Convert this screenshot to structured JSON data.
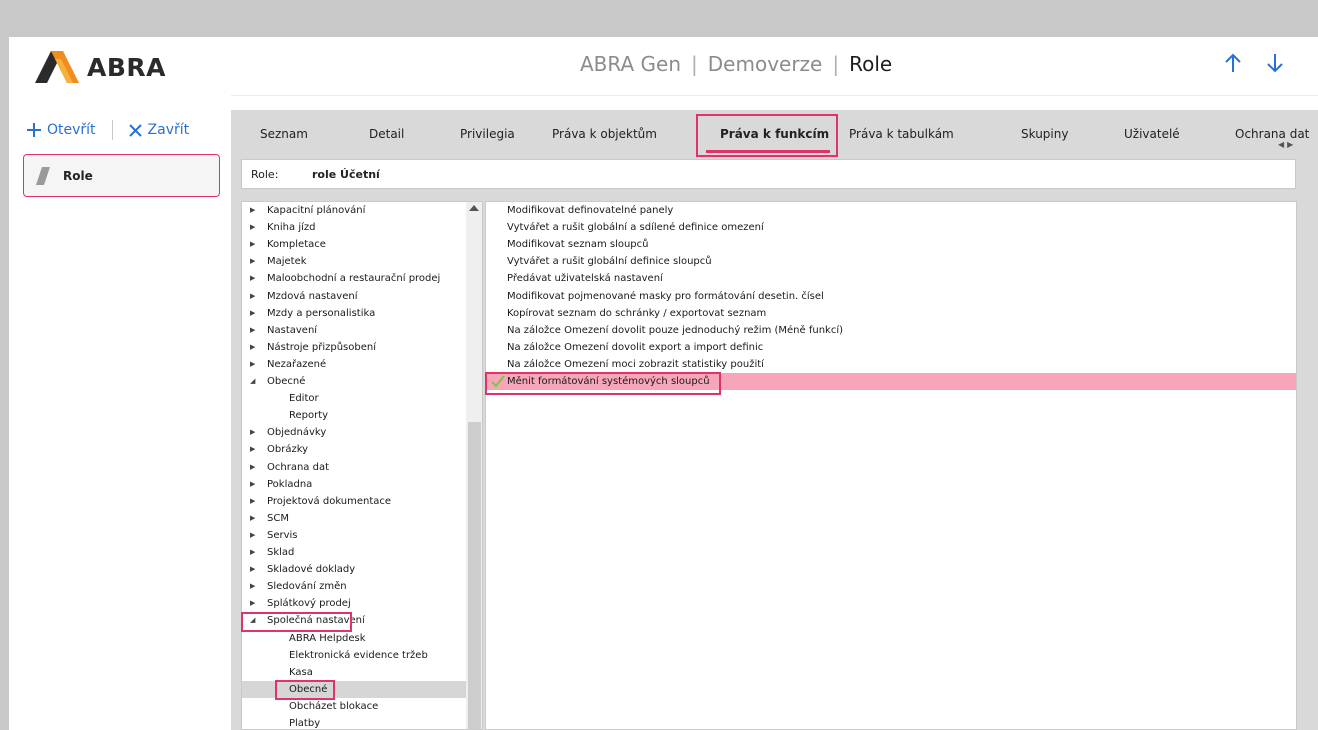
{
  "app": {
    "logo_text": "ABRA",
    "title_parts": [
      "ABRA Gen",
      "Demoverze",
      "Role"
    ]
  },
  "nav": {
    "up_icon": "arrow-up-icon",
    "down_icon": "arrow-down-icon"
  },
  "actions": {
    "open_label": "Otevřít",
    "close_label": "Zavřít"
  },
  "left": {
    "role_label": "Role"
  },
  "tabs": [
    {
      "label": "Seznam",
      "active": false
    },
    {
      "label": "Detail",
      "active": false
    },
    {
      "label": "Privilegia",
      "active": false
    },
    {
      "label": "Práva k objektům",
      "active": false
    },
    {
      "label": "Práva k funkcím",
      "active": true
    },
    {
      "label": "Práva k tabulkám",
      "active": false
    },
    {
      "label": "Skupiny",
      "active": false
    },
    {
      "label": "Uživatelé",
      "active": false
    },
    {
      "label": "Ochrana dat",
      "active": false
    }
  ],
  "role_bar": {
    "key": "Role:",
    "value": "role Účetní"
  },
  "tree": [
    {
      "label": "Kapacitní plánování",
      "level": 0,
      "state": "collapsed"
    },
    {
      "label": "Kniha jízd",
      "level": 0,
      "state": "collapsed"
    },
    {
      "label": "Kompletace",
      "level": 0,
      "state": "collapsed"
    },
    {
      "label": "Majetek",
      "level": 0,
      "state": "collapsed"
    },
    {
      "label": "Maloobchodní a restaurační prodej",
      "level": 0,
      "state": "collapsed"
    },
    {
      "label": "Mzdová nastavení",
      "level": 0,
      "state": "collapsed"
    },
    {
      "label": "Mzdy a personalistika",
      "level": 0,
      "state": "collapsed"
    },
    {
      "label": "Nastavení",
      "level": 0,
      "state": "collapsed"
    },
    {
      "label": "Nástroje přizpůsobení",
      "level": 0,
      "state": "collapsed"
    },
    {
      "label": "Nezařazené",
      "level": 0,
      "state": "collapsed"
    },
    {
      "label": "Obecné",
      "level": 0,
      "state": "expanded"
    },
    {
      "label": "Editor",
      "level": 1,
      "state": "leaf"
    },
    {
      "label": "Reporty",
      "level": 1,
      "state": "leaf"
    },
    {
      "label": "Objednávky",
      "level": 0,
      "state": "collapsed"
    },
    {
      "label": "Obrázky",
      "level": 0,
      "state": "collapsed"
    },
    {
      "label": "Ochrana dat",
      "level": 0,
      "state": "collapsed"
    },
    {
      "label": "Pokladna",
      "level": 0,
      "state": "collapsed"
    },
    {
      "label": "Projektová dokumentace",
      "level": 0,
      "state": "collapsed"
    },
    {
      "label": "SCM",
      "level": 0,
      "state": "collapsed"
    },
    {
      "label": "Servis",
      "level": 0,
      "state": "collapsed"
    },
    {
      "label": "Sklad",
      "level": 0,
      "state": "collapsed"
    },
    {
      "label": "Skladové doklady",
      "level": 0,
      "state": "collapsed"
    },
    {
      "label": "Sledování změn",
      "level": 0,
      "state": "collapsed"
    },
    {
      "label": "Splátkový prodej",
      "level": 0,
      "state": "collapsed"
    },
    {
      "label": "Společná nastavení",
      "level": 0,
      "state": "expanded"
    },
    {
      "label": "ABRA Helpdesk",
      "level": 1,
      "state": "leaf"
    },
    {
      "label": "Elektronická evidence tržeb",
      "level": 1,
      "state": "leaf"
    },
    {
      "label": "Kasa",
      "level": 1,
      "state": "leaf"
    },
    {
      "label": "Obecné",
      "level": 1,
      "state": "leaf",
      "selected": true
    },
    {
      "label": "Obcházet blokace",
      "level": 1,
      "state": "leaf"
    },
    {
      "label": "Platby",
      "level": 1,
      "state": "leaf"
    }
  ],
  "functions": [
    {
      "label": "Modifikovat definovatelné panely",
      "checked": false
    },
    {
      "label": "Vytvářet a rušit globální a sdílené definice omezení",
      "checked": false
    },
    {
      "label": "Modifikovat seznam sloupců",
      "checked": false
    },
    {
      "label": "Vytvářet a rušit globální definice sloupců",
      "checked": false
    },
    {
      "label": "Předávat uživatelská nastavení",
      "checked": false
    },
    {
      "label": "Modifikovat pojmenované masky pro formátování desetin. čísel",
      "checked": false
    },
    {
      "label": "Kopírovat seznam do schránky / exportovat seznam",
      "checked": false
    },
    {
      "label": "Na záložce Omezení dovolit pouze jednoduchý režim (Méně funkcí)",
      "checked": false
    },
    {
      "label": "Na záložce Omezení dovolit export a import definic",
      "checked": false
    },
    {
      "label": "Na záložce Omezení moci zobrazit statistiky použití",
      "checked": false
    },
    {
      "label": "Měnit formátování systémových sloupců",
      "checked": true,
      "highlighted": true
    }
  ],
  "colors": {
    "accent": "#e0336a",
    "link": "#2a6fd6",
    "highlight_row": "#f6a6b8",
    "check": "#7ac943"
  }
}
